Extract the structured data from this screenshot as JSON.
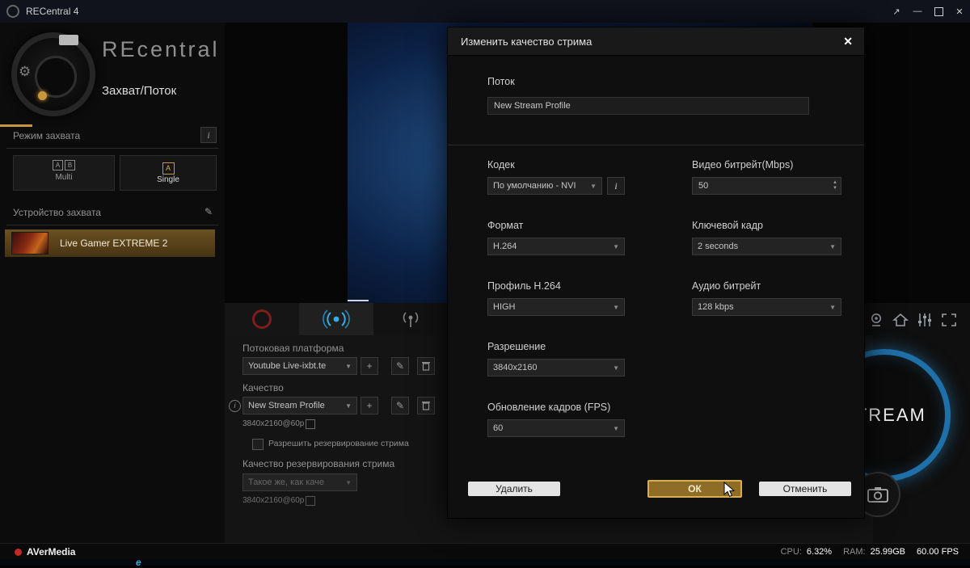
{
  "icons": {
    "caret": "▼",
    "up": "▲",
    "down": "▼",
    "plus": "+",
    "pencil": "✎",
    "info": "i",
    "close": "✕",
    "popout": "↗",
    "minimize": "—",
    "home": "⌂",
    "gear": "⚙",
    "edge": "e"
  },
  "colors": {
    "gold": "#c9973b",
    "blue": "#2fa8e1",
    "record_red": "#7f1d1d"
  },
  "window": {
    "title": "RECentral 4"
  },
  "sidebar": {
    "brand": "REcentral",
    "page_title": "Захват/Поток",
    "capture_mode_label": "Режим захвата",
    "multi_label": "Multi",
    "multi_icon_a": "A",
    "multi_icon_b": "B",
    "single_label": "Single",
    "single_icon_a": "A",
    "device_label": "Устройство захвата",
    "device_name": "Live Gamer EXTREME 2"
  },
  "stream_panel": {
    "platform_label": "Потоковая платформа",
    "platform_value": "Youtube Live-ixbt.te",
    "quality_label": "Качество",
    "quality_value": "New Stream Profile",
    "quality_detail": "3840x2160@60p",
    "backup_checkbox_label": "Разрешить резервирование стрима",
    "backup_label": "Качество резервирования стрима",
    "backup_value": "Такое же, как каче",
    "backup_detail": "3840x2160@60p"
  },
  "right_panel": {
    "stream_button_label": "STREAM"
  },
  "statusbar": {
    "brand": "AVerMedia",
    "cpu_label": "CPU:",
    "cpu_value": "6.32%",
    "ram_label": "RAM:",
    "ram_value": "25.99GB",
    "fps_value": "60.00 FPS"
  },
  "dialog": {
    "title": "Изменить качество стрима",
    "stream_field": {
      "label": "Поток",
      "value": "New Stream Profile"
    },
    "fields_left": [
      {
        "label": "Кодек",
        "value": "По умолчанию - NVI"
      },
      {
        "label": "Формат",
        "value": "H.264"
      },
      {
        "label": "Профиль H.264",
        "value": "HIGH"
      },
      {
        "label": "Разрешение",
        "value": "3840x2160"
      },
      {
        "label": "Обновление кадров (FPS)",
        "value": "60"
      }
    ],
    "fields_right": [
      {
        "label": "Видео битрейт(Mbps)",
        "value": "50"
      },
      {
        "label": "Ключевой кадр",
        "value": "2 seconds"
      },
      {
        "label": "Аудио битрейт",
        "value": "128 kbps"
      }
    ],
    "buttons": {
      "delete": "Удалить",
      "ok": "ОК",
      "cancel": "Отменить"
    }
  }
}
